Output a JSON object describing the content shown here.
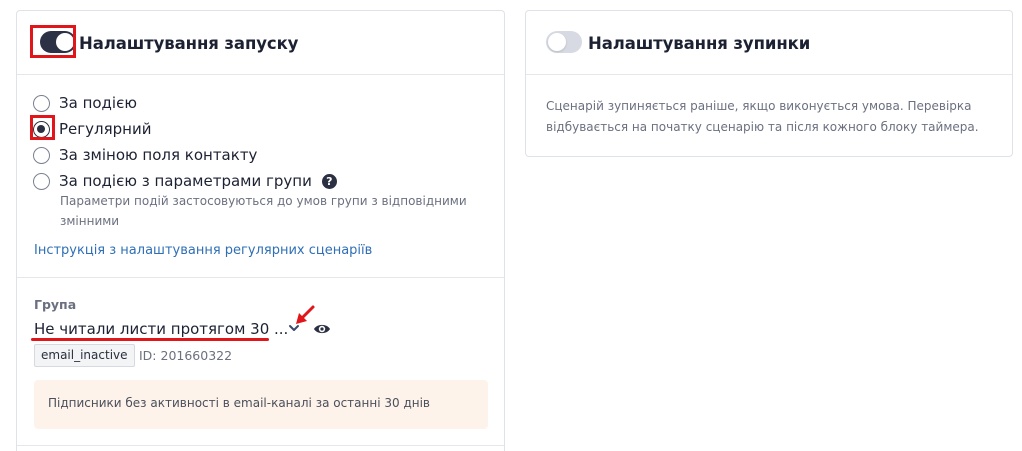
{
  "launch": {
    "title": "Налаштування запуску",
    "toggle_on": true,
    "options": [
      {
        "label": "За подією",
        "checked": false
      },
      {
        "label": "Регулярний",
        "checked": true
      },
      {
        "label": "За зміною поля контакту",
        "checked": false
      },
      {
        "label": "За подією з параметрами групи",
        "checked": false
      }
    ],
    "group_params_hint": "Параметри подій застосовуються до умов групи з відповідними змінними",
    "help_icon_glyph": "?",
    "instruction_link": "Інструкція з налаштування регулярних сценаріїв",
    "group": {
      "label": "Група",
      "name": "Не читали листи протягом 30 ...",
      "tag": "email_inactive",
      "id_text": "ID: 201660322",
      "description": "Підписники без активності в email-каналі за останні 30 днів"
    }
  },
  "stop": {
    "title": "Налаштування зупинки",
    "toggle_on": false,
    "description": "Сценарій зупиняється раніше, якщо виконується умова. Перевірка відбувається на початку сценарію та після кожного блоку таймера."
  },
  "icons": {
    "group_select": "chevron-down-icon",
    "group_preview": "eye-icon",
    "help": "question-circle-icon",
    "annotation": "red-arrow-annotation"
  },
  "colors": {
    "toggle_on": "#2c3145",
    "toggle_off": "#d7dae3",
    "link": "#2f6fb7",
    "annotation_red": "#e0161b",
    "info_box_bg": "#fdf3ea"
  }
}
